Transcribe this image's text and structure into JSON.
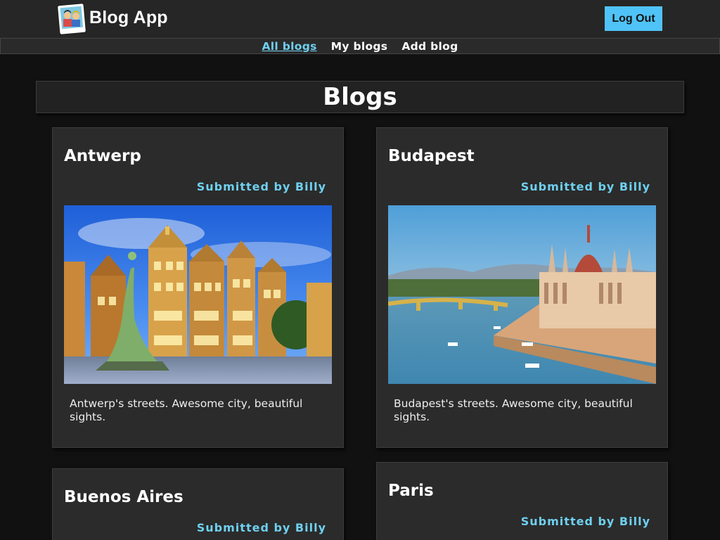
{
  "header": {
    "app_title": "Blog App",
    "logout_label": "Log Out",
    "accent_color": "#4fc3f7"
  },
  "nav": {
    "items": [
      {
        "label": "All blogs",
        "active": true
      },
      {
        "label": "My blogs",
        "active": false
      },
      {
        "label": "Add blog",
        "active": false
      }
    ]
  },
  "main": {
    "title": "Blogs",
    "cards": [
      {
        "title": "Antwerp",
        "author": "Submitted by Billy",
        "image": "antwerp-square-photo",
        "description": "Antwerp's streets. Awesome city, beautiful sights."
      },
      {
        "title": "Budapest",
        "author": "Submitted by Billy",
        "image": "budapest-parliament-photo",
        "description": "Budapest's streets. Awesome city, beautiful sights."
      },
      {
        "title": "Buenos Aires",
        "author": "Submitted by Billy"
      },
      {
        "title": "Paris",
        "author": "Submitted by Billy"
      }
    ]
  }
}
